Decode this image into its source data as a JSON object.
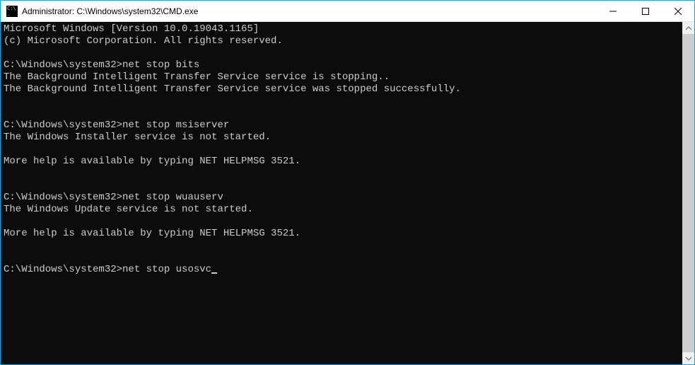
{
  "titlebar": {
    "title": "Administrator: C:\\Windows\\system32\\CMD.exe"
  },
  "terminal": {
    "prompt": "C:\\Windows\\system32>",
    "lines": [
      "Microsoft Windows [Version 10.0.19043.1165]",
      "(c) Microsoft Corporation. All rights reserved.",
      "",
      "C:\\Windows\\system32>net stop bits",
      "The Background Intelligent Transfer Service service is stopping..",
      "The Background Intelligent Transfer Service service was stopped successfully.",
      "",
      "",
      "C:\\Windows\\system32>net stop msiserver",
      "The Windows Installer service is not started.",
      "",
      "More help is available by typing NET HELPMSG 3521.",
      "",
      "",
      "C:\\Windows\\system32>net stop wuauserv",
      "The Windows Update service is not started.",
      "",
      "More help is available by typing NET HELPMSG 3521.",
      "",
      ""
    ],
    "current_input": "net stop usosvc"
  }
}
